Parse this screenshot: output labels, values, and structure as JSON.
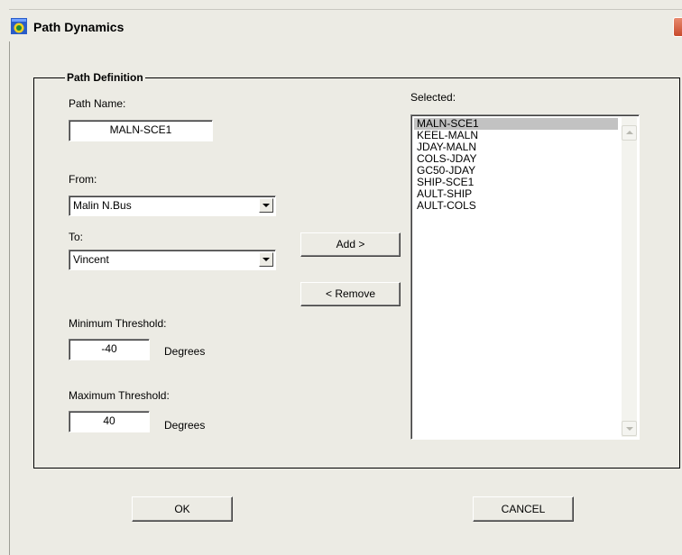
{
  "window": {
    "title": "Path Dynamics",
    "icon": "app-icon"
  },
  "group": {
    "legend": "Path Definition"
  },
  "path_name": {
    "label": "Path Name:",
    "value": "MALN-SCE1"
  },
  "from": {
    "label": "From:",
    "value": "Malin N.Bus"
  },
  "to": {
    "label": "To:",
    "value": "Vincent"
  },
  "min_threshold": {
    "label": "Minimum Threshold:",
    "value": "-40",
    "unit": "Degrees"
  },
  "max_threshold": {
    "label": "Maximum Threshold:",
    "value": "40",
    "unit": "Degrees"
  },
  "buttons": {
    "add": "Add >",
    "remove": "< Remove",
    "ok": "OK",
    "cancel": "CANCEL"
  },
  "selected": {
    "label": "Selected:",
    "items": [
      "MALN-SCE1",
      "KEEL-MALN",
      "JDAY-MALN",
      "COLS-JDAY",
      "GC50-JDAY",
      "SHIP-SCE1",
      "AULT-SHIP",
      "AULT-COLS"
    ],
    "selected_index": 0
  }
}
